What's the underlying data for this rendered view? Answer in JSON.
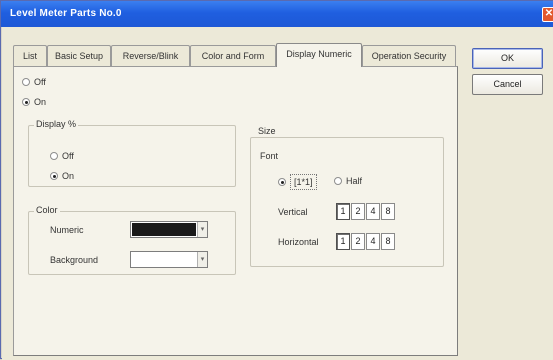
{
  "window": {
    "title": "Level Meter Parts No.0"
  },
  "tabs": [
    {
      "label": "List"
    },
    {
      "label": "Basic Setup"
    },
    {
      "label": "Reverse/Blink"
    },
    {
      "label": "Color and Form"
    },
    {
      "label": "Display Numeric",
      "active": true
    },
    {
      "label": "Operation Security"
    }
  ],
  "buttons": {
    "ok": "OK",
    "cancel": "Cancel"
  },
  "display": {
    "off_label": "Off",
    "on_label": "On",
    "selected": "On"
  },
  "display_percent": {
    "title": "Display %",
    "off_label": "Off",
    "on_label": "On",
    "selected": "On"
  },
  "color": {
    "title": "Color",
    "numeric_label": "Numeric",
    "background_label": "Background",
    "numeric_color": "#1a1a1a",
    "background_color": "#ffffff"
  },
  "size": {
    "title": "Size",
    "font_label": "Font",
    "font_full_label": "[1*1]",
    "font_half_label": "Half",
    "font_selected": "[1*1]",
    "vertical_label": "Vertical",
    "horizontal_label": "Horizontal",
    "options": [
      "1",
      "2",
      "4",
      "8"
    ],
    "vertical_selected": "1",
    "horizontal_selected": "1"
  }
}
